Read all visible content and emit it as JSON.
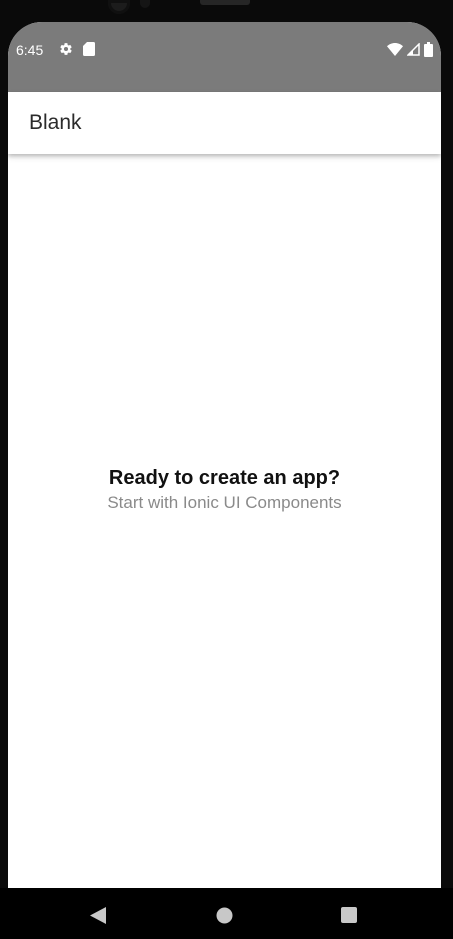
{
  "status_bar": {
    "time": "6:45",
    "left_icons": [
      "gear-icon",
      "sd-card-icon"
    ],
    "right_icons": [
      "wifi-icon",
      "cell-signal-icon",
      "battery-icon"
    ],
    "background_color": "#7b7b7b"
  },
  "toolbar": {
    "title": "Blank"
  },
  "empty_state": {
    "title": "Ready to create an app?",
    "subtitle": "Start with Ionic UI Components"
  },
  "navigation_bar": {
    "buttons": [
      "back-icon",
      "home-icon",
      "recents-icon"
    ]
  }
}
